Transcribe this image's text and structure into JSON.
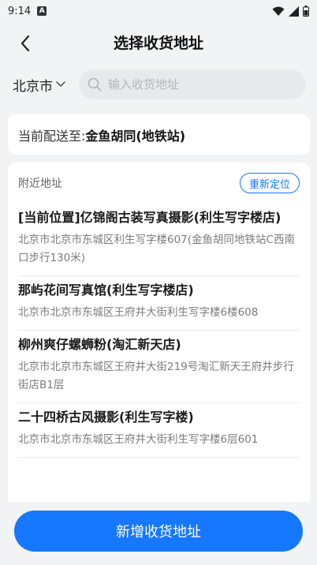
{
  "status_bar": {
    "time": "9:14",
    "badge": "A",
    "icons": [
      "wifi-icon",
      "signal-icon",
      "battery-icon"
    ]
  },
  "nav": {
    "title": "选择收货地址",
    "back_icon": "chevron-left-icon"
  },
  "search": {
    "city": "北京市",
    "placeholder": "输入收货地址"
  },
  "current": {
    "label": "当前配送至: ",
    "value": "金鱼胡同(地铁站)"
  },
  "nearby": {
    "title": "附近地址",
    "relocate_label": "重新定位",
    "items": [
      {
        "name": "[当前位置]亿锦阁古装写真摄影(利生写字楼店)",
        "detail": "北京市北京市东城区利生写字楼607(金鱼胡同地铁站C西南口步行130米)"
      },
      {
        "name": "那屿花间写真馆(利生写字楼店)",
        "detail": "北京市北京市东城区王府井大街利生写字楼6楼608"
      },
      {
        "name": "柳州爽仔螺蛳粉(淘汇新天店)",
        "detail": "北京市北京市东城区王府井大街219号淘汇新天王府井步行街店B1层"
      },
      {
        "name": "二十四桥古风摄影(利生写字楼)",
        "detail": "北京市北京市东城区王府井大街利生写字楼6层601"
      }
    ]
  },
  "footer": {
    "add_label": "新增收货地址"
  },
  "colors": {
    "accent": "#1677ff",
    "background": "#f2f3f5"
  }
}
